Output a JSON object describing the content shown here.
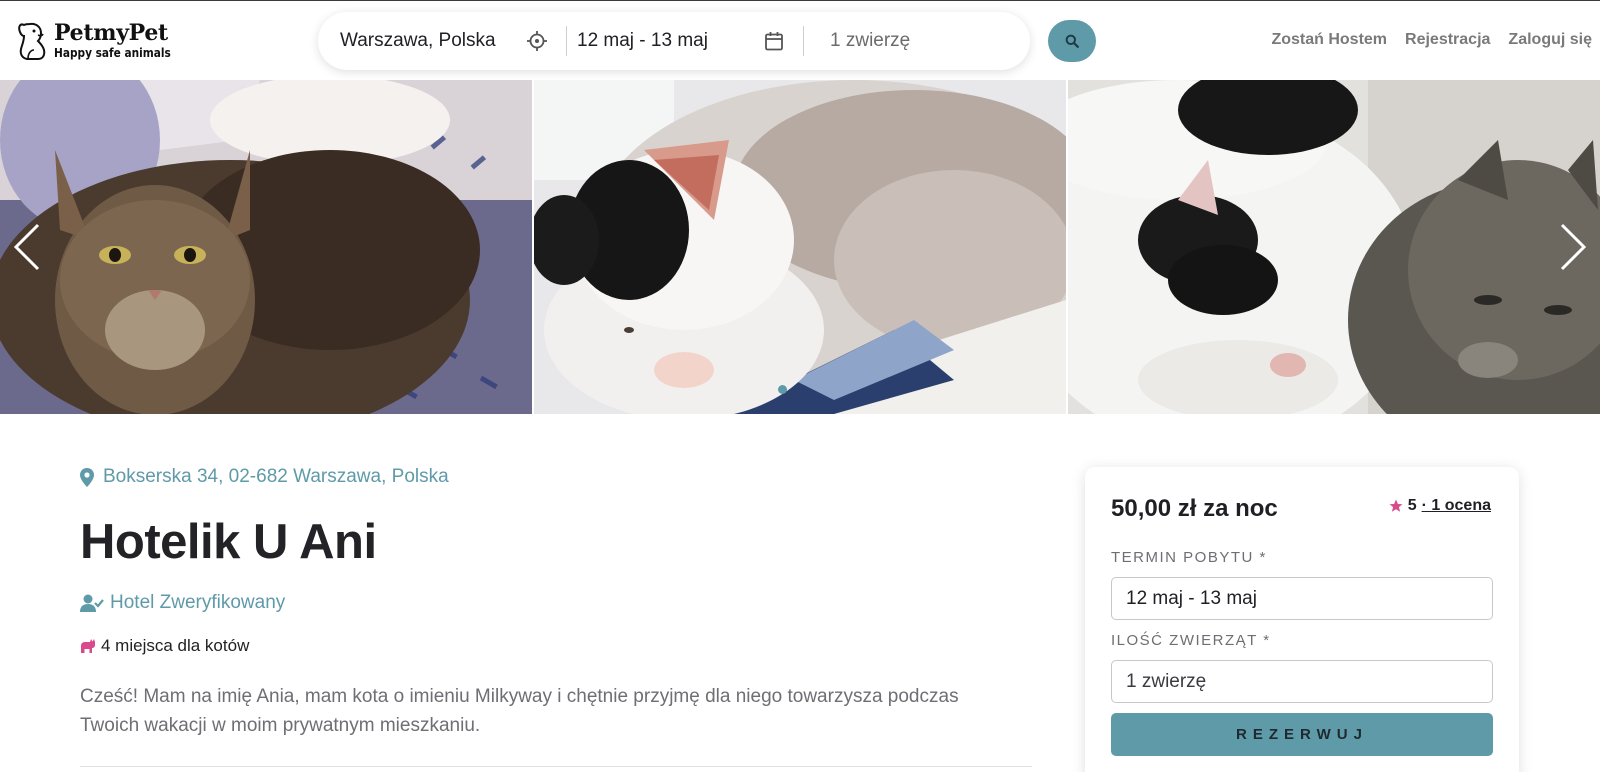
{
  "logo": {
    "title": "PetmyPet",
    "tagline": "Happy safe animals"
  },
  "search": {
    "location": "Warszawa, Polska",
    "dates": "12 maj - 13 maj",
    "pets": "1 zwierzę",
    "location_icon": "crosshair-icon",
    "date_icon": "calendar-icon",
    "button_icon": "search-icon"
  },
  "nav": {
    "host": "Zostań Hostem",
    "register": "Rejestracja",
    "login": "Zaloguj się"
  },
  "gallery": {
    "photos": [
      "tabby-cat-on-blanket",
      "black-white-cat-on-book",
      "two-cats-on-bed"
    ],
    "active_dot": 1,
    "prev_icon": "chevron-left-icon",
    "next_icon": "chevron-right-icon"
  },
  "listing": {
    "address": "Bokserska 34, 02-682 Warszawa, Polska",
    "title": "Hotelik U Ani",
    "verified": "Hotel Zweryfikowany",
    "capacity": "4 miejsca dla kotów",
    "description": "Cześć! Mam na imię Ania, mam kota o imieniu Milkyway i chętnie przyjmę dla niego towarzysza podczas Twoich wakacji w moim prywatnym mieszkaniu."
  },
  "booking": {
    "price": "50,00 zł za noc",
    "rating_value": "5",
    "rating_link": "· 1 ocena",
    "dates_label": "TERMIN POBYTU *",
    "dates_value": "12 maj - 13 maj",
    "pets_label": "ILOŚĆ ZWIERZĄT *",
    "pets_value": "1 zwierzę",
    "reserve": "REZERWUJ"
  },
  "colors": {
    "accent": "#5f9aa9",
    "star": "#d94a8c",
    "text": "#1f1f24",
    "muted": "#6e6e74"
  }
}
